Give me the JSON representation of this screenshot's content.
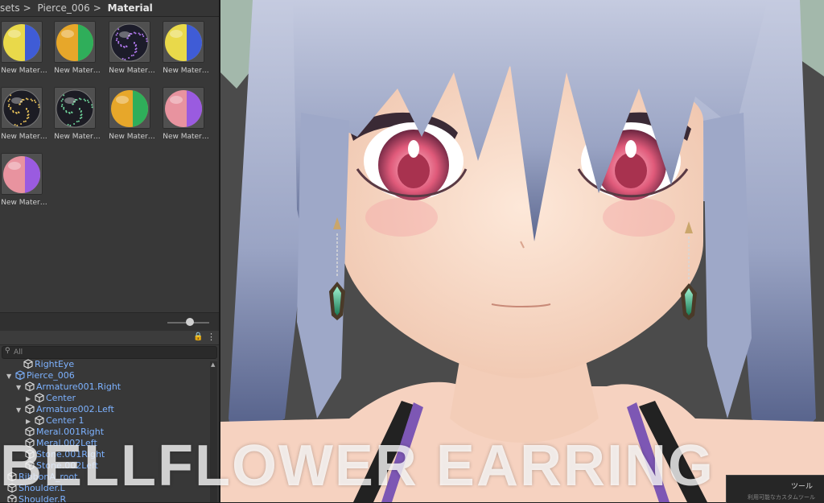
{
  "project": {
    "breadcrumb": [
      "sets",
      "Pierce_006",
      "Material"
    ],
    "separator": ">",
    "materials": [
      {
        "label": "New Mater…",
        "style": "yellow-blue"
      },
      {
        "label": "New Mater…",
        "style": "orange-green"
      },
      {
        "label": "New Mater…",
        "style": "glass-purple"
      },
      {
        "label": "New Mater…",
        "style": "yellow-blue"
      },
      {
        "label": "New Mater…",
        "style": "glass-gold"
      },
      {
        "label": "New Mater…",
        "style": "glass-green"
      },
      {
        "label": "New Mater…",
        "style": "orange-green"
      },
      {
        "label": "New Mater…",
        "style": "pink-purple"
      },
      {
        "label": "New Mater…",
        "style": "pink-purple"
      }
    ]
  },
  "hierarchy": {
    "search_placeholder": "All",
    "lock_icon": "lock-icon",
    "menu_icon": "kebab-menu-icon",
    "rows": [
      {
        "label": "RightEye",
        "blue": true,
        "arrow": ""
      },
      {
        "label": "Pierce_006",
        "blue": true,
        "arrow": "▼",
        "prefab": true
      },
      {
        "label": "Armature001.Right",
        "blue": true,
        "arrow": "▼"
      },
      {
        "label": "Center",
        "blue": true,
        "arrow": "▶"
      },
      {
        "label": "Armature002.Left",
        "blue": true,
        "arrow": "▼"
      },
      {
        "label": "Center 1",
        "blue": true,
        "arrow": "▶"
      },
      {
        "label": "Meral.001Right",
        "blue": true,
        "arrow": ""
      },
      {
        "label": "Meral.002Left",
        "blue": true,
        "arrow": ""
      },
      {
        "label": "Stone.001Right",
        "blue": true,
        "arrow": ""
      },
      {
        "label": "Stone.002Left",
        "blue": true,
        "arrow": ""
      },
      {
        "label": "RibbonA_root",
        "blue": true,
        "arrow": ""
      },
      {
        "label": "Shoulder.L",
        "blue": true,
        "arrow": ""
      },
      {
        "label": "Shoulder.R",
        "blue": true,
        "arrow": ""
      }
    ]
  },
  "overlay": {
    "title": "BELLFLOWER EARRING",
    "toolbox_title": "ツール",
    "toolbox_sub": "利用可能なカスタムツール"
  },
  "colors": {
    "panel": "#383838",
    "viewport_bg": "#4b4b4b",
    "hierarchy_blue": "#7db2ff",
    "hair": "#a7b0cc",
    "eye": "#e05a7a"
  }
}
